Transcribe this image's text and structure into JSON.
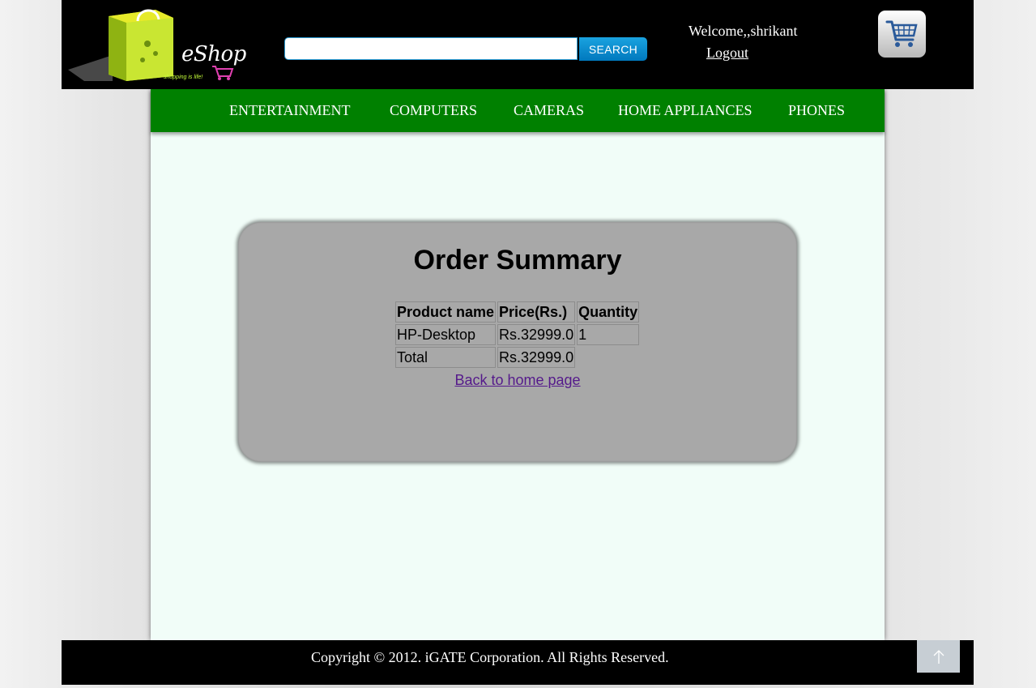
{
  "header": {
    "logo_text": "eShop",
    "logo_tagline": "shopping is life!",
    "search": {
      "value": "",
      "placeholder": "",
      "button_label": "SEARCH"
    },
    "welcome_text": "Welcome,,shrikant",
    "logout_label": "Logout",
    "cart_icon": "shopping-cart-icon"
  },
  "nav": {
    "items": [
      {
        "label": "ENTERTAINMENT"
      },
      {
        "label": "COMPUTERS"
      },
      {
        "label": "CAMERAS"
      },
      {
        "label": "HOME APPLIANCES"
      },
      {
        "label": "PHONES"
      }
    ]
  },
  "order_summary": {
    "title": "Order Summary",
    "columns": [
      "Product name",
      "Price(Rs.)",
      "Quantity"
    ],
    "rows": [
      {
        "product": "HP-Desktop",
        "price": "Rs.32999.0",
        "quantity": "1"
      }
    ],
    "total": {
      "label": "Total",
      "price": "Rs.32999.0"
    },
    "back_link": "Back to home page"
  },
  "footer": {
    "copyright": "Copyright © 2012. iGATE Corporation. All Rights Reserved.",
    "top_icon": "arrow-up-icon"
  },
  "colors": {
    "header_bg": "#000000",
    "nav_bg": "#008000",
    "panel_bg": "#a8a8a8",
    "content_bg": "#f1fdf8",
    "search_button": "#0088cc",
    "link_visited": "#551a8b"
  }
}
